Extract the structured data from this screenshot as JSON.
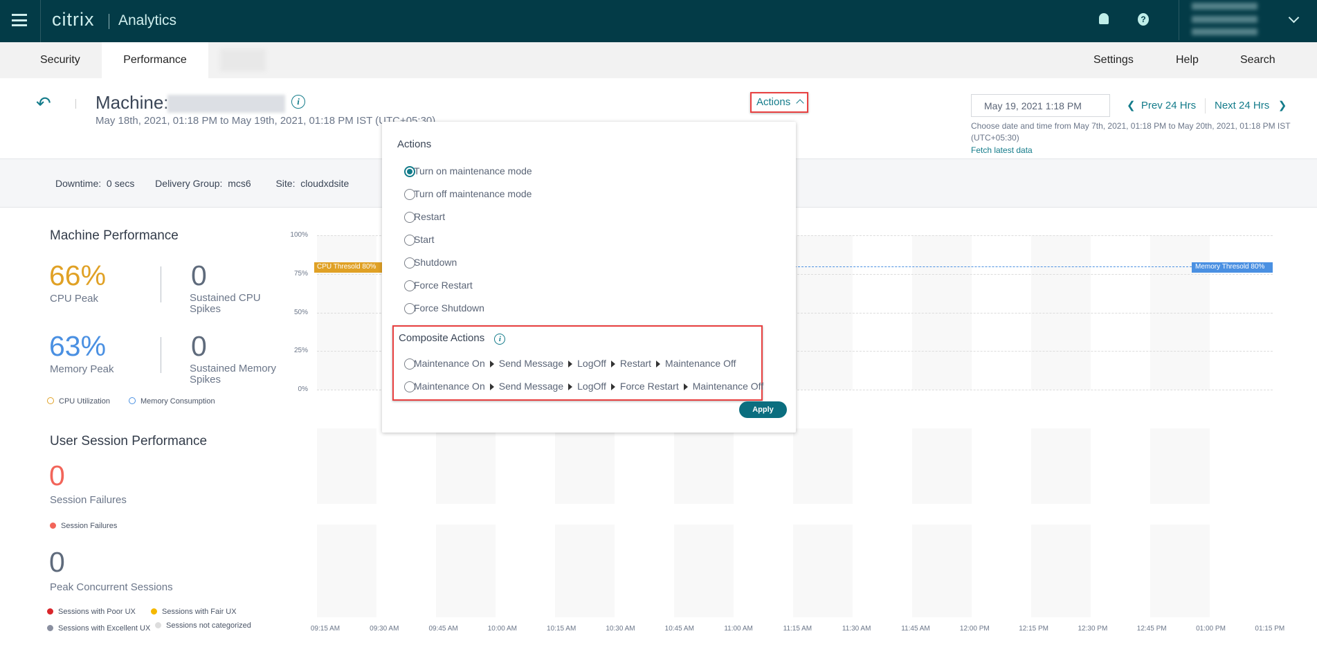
{
  "header": {
    "app_logo": "citrix",
    "app_name": "Analytics",
    "icons": [
      "menu-icon",
      "bell-icon",
      "help-icon",
      "chevron-down-icon"
    ]
  },
  "tabs": [
    {
      "label": "Security"
    },
    {
      "label": "Performance",
      "active": true
    }
  ],
  "right_nav": {
    "settings": "Settings",
    "help": "Help",
    "search": "Search"
  },
  "page": {
    "title_prefix": "Machine:",
    "subtitle": "May 18th, 2021, 01:18 PM to May 19th, 2021, 01:18 PM IST (UTC+05:30)",
    "actions_label": "Actions"
  },
  "date_nav": {
    "date_value": "May 19, 2021 1:18 PM",
    "prev": "Prev 24 Hrs",
    "next": "Next 24 Hrs",
    "hint": "Choose date and time from May 7th, 2021, 01:18 PM to May 20th, 2021, 01:18 PM IST (UTC+05:30)",
    "fetch": "Fetch latest data"
  },
  "info": {
    "downtime_label": "Downtime:",
    "downtime_value": "0 secs",
    "dg_label": "Delivery Group:",
    "dg_value": "mcs6",
    "site_label": "Site:",
    "site_value": "cloudxdsite"
  },
  "machine_perf": {
    "title": "Machine Performance",
    "cpu_peak": "66%",
    "cpu_peak_label": "CPU Peak",
    "cpu_spikes": "0",
    "cpu_spikes_label": "Sustained CPU Spikes",
    "mem_peak": "63%",
    "mem_peak_label": "Memory Peak",
    "mem_spikes": "0",
    "mem_spikes_label": "Sustained Memory Spikes",
    "legend_cpu": "CPU Utilization",
    "legend_mem": "Memory Consumption"
  },
  "session_perf": {
    "title": "User Session Performance",
    "failures": "0",
    "failures_label": "Session Failures",
    "legend_failures": "Session Failures",
    "peak": "0",
    "peak_label": "Peak Concurrent Sessions",
    "legend_poor": "Sessions with Poor UX",
    "legend_fair": "Sessions with Fair UX",
    "legend_excellent": "Sessions with Excellent UX",
    "legend_uncat": "Sessions not categorized"
  },
  "actions_popup": {
    "title": "Actions",
    "options": [
      "Turn on maintenance mode",
      "Turn off maintenance mode",
      "Restart",
      "Start",
      "Shutdown",
      "Force Restart",
      "Force Shutdown"
    ],
    "selected": 0,
    "composite_title": "Composite Actions",
    "composite": [
      [
        "Maintenance On",
        "Send Message",
        "LogOff",
        "Restart",
        "Maintenance Off"
      ],
      [
        "Maintenance On",
        "Send Message",
        "LogOff",
        "Force Restart",
        "Maintenance Off"
      ]
    ],
    "apply": "Apply"
  },
  "colors": {
    "topbar": "#033b47",
    "accent": "#137b8a",
    "cpu": "#e0a125",
    "memory": "#4a90e2",
    "failure": "#f2655a"
  },
  "chart_data": {
    "type": "line",
    "ylim": [
      0,
      100
    ],
    "yticks": [
      "100%",
      "75%",
      "50%",
      "25%",
      "0%"
    ],
    "x": [
      "09:15 AM",
      "09:30 AM",
      "09:45 AM",
      "10:00 AM",
      "10:15 AM",
      "10:30 AM",
      "10:45 AM",
      "11:00 AM",
      "11:15 AM",
      "11:30 AM",
      "11:45 AM",
      "12:00 PM",
      "12:15 PM",
      "12:30 PM",
      "12:45 PM",
      "01:00 PM",
      "01:15 PM"
    ],
    "thresholds": [
      {
        "label": "CPU Thresold 80%",
        "value": 80
      },
      {
        "label": "Memory Thresold 80%",
        "value": 80
      }
    ],
    "series": []
  }
}
